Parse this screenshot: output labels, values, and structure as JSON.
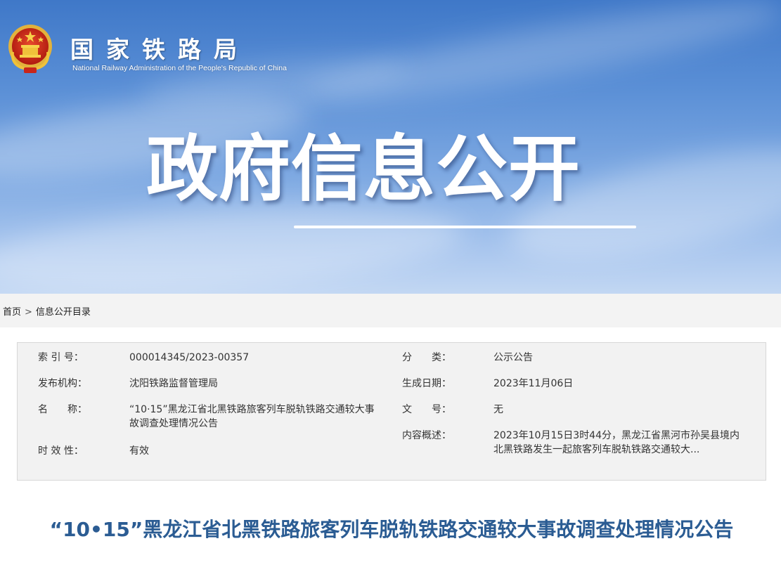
{
  "header": {
    "logo_cn": "国家铁路局",
    "logo_en": "National Railway Administration of the People's Republic of China",
    "banner_title": "政府信息公开"
  },
  "breadcrumb": {
    "home": "首页",
    "separator": ">",
    "current": "信息公开目录"
  },
  "info": {
    "index_label": "索 引 号：",
    "index_value": "000014345/2023-00357",
    "category_label": "分　　类：",
    "category_value": "公示公告",
    "publisher_label": "发布机构：",
    "publisher_value": "沈阳铁路监督管理局",
    "date_label": "生成日期：",
    "date_value": "2023年11月06日",
    "name_label": "名　　称：",
    "name_value": "“10·15”黑龙江省北黑铁路旅客列车脱轨铁路交通较大事故调查处理情况公告",
    "docno_label": "文　　号：",
    "docno_value": "无",
    "summary_label": "内容概述：",
    "summary_value": "2023年10月15日3时44分，黑龙江省黑河市孙吴县境内北黑铁路发生一起旅客列车脱轨铁路交通较大...",
    "validity_label": "时 效 性：",
    "validity_value": "有效"
  },
  "article": {
    "title": "“10•15”黑龙江省北黑铁路旅客列车脱轨铁路交通较大事故调查处理情况公告"
  },
  "colors": {
    "banner_top": "#3f78c8",
    "banner_bottom": "#c2d7f3",
    "title_blue": "#2b5c93",
    "info_bg": "#f2f2f2",
    "breadcrumb_bg": "#f3f3f3"
  }
}
